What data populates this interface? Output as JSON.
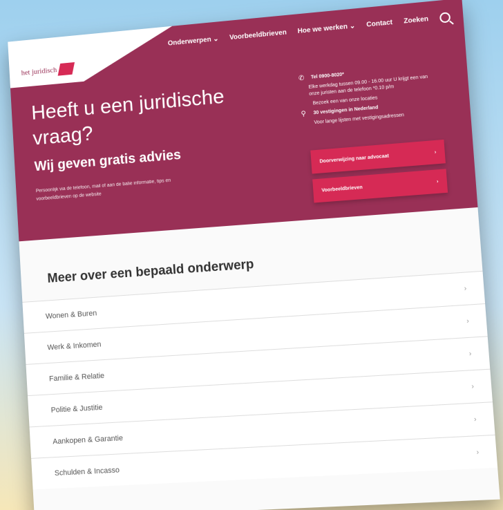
{
  "logo": {
    "text": "het juridisch"
  },
  "nav": {
    "items": [
      "Onderwerpen ⌄",
      "Voorbeeldbrieven",
      "Hoe we werken ⌄",
      "Contact",
      "Zoeken"
    ]
  },
  "hero": {
    "headline": "Heeft u een juridische vraag?",
    "subhead": "Wij geven gratis advies",
    "intro": "Persoonlijk via de telefoon, mail of aan de balie informatie, tips en voorbeeldbrieven op de website"
  },
  "contact": {
    "phone": "Tel 0900-8020*",
    "hours": "Elke werkdag tussen 09.00 - 16.00 uur U krijgt een van onze juristen aan de telefoon *0.10 p/m",
    "visit": "Bezoek een van onze locaties",
    "locations": "30 vestigingen in Nederland",
    "locations_note": "Voor lange lijsten met vestigingsadressen"
  },
  "cta": {
    "primary": "Doorverwijzing naar advocaat",
    "secondary": "Voorbeeldbrieven"
  },
  "topics": {
    "title": "Meer over een bepaald onderwerp",
    "items": [
      "Wonen & Buren",
      "Werk & Inkomen",
      "Familie & Relatie",
      "Politie & Justitie",
      "Aankopen & Garantie",
      "Schulden & Incasso"
    ]
  }
}
